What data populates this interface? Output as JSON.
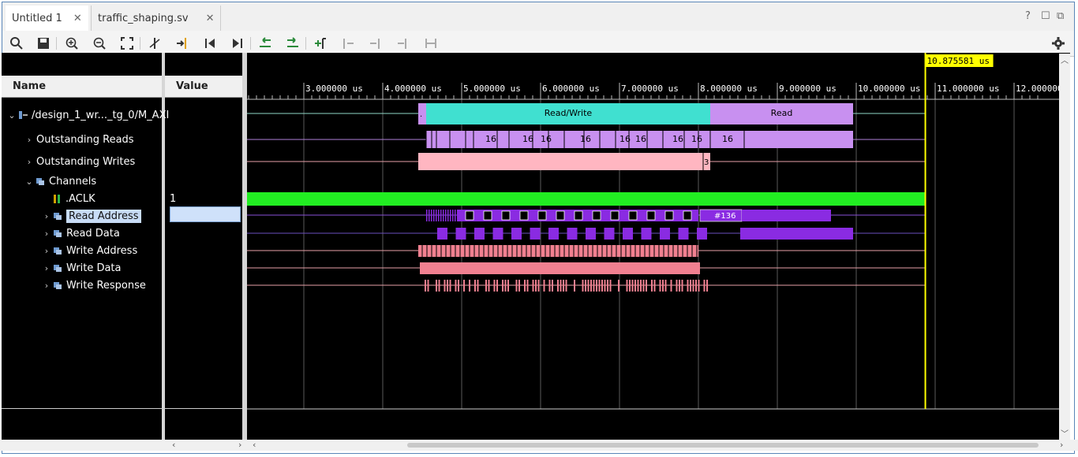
{
  "tabs": [
    {
      "label": "Untitled 1",
      "active": true
    },
    {
      "label": "traffic_shaping.sv",
      "active": false
    }
  ],
  "window_controls": {
    "help": "?",
    "restore": "☐",
    "maximize": "⧉"
  },
  "toolbar": {
    "icons": [
      "search-icon",
      "save-icon",
      "zoom-in-icon",
      "zoom-out-icon",
      "zoom-fit-icon",
      "cursor-icon",
      "go-to-cursor-icon",
      "go-to-start-icon",
      "go-to-end-icon",
      "previous-transition-icon",
      "next-transition-icon",
      "add-marker-icon",
      "previous-marker-icon",
      "next-marker-icon",
      "swap-cursors-icon",
      "snap-icon",
      "settings-icon"
    ]
  },
  "columns": {
    "name": "Name",
    "value": "Value"
  },
  "signals": [
    {
      "label": "/design_1_wr..._tg_0/M_AXI",
      "indent": 0,
      "chev": "⌄",
      "icon": "top",
      "value": ""
    },
    {
      "label": "Outstanding Reads",
      "indent": 1,
      "chev": "›",
      "icon": "",
      "value": ""
    },
    {
      "label": "Outstanding Writes",
      "indent": 1,
      "chev": "›",
      "icon": "",
      "value": ""
    },
    {
      "label": "Channels",
      "indent": 1,
      "chev": "⌄",
      "icon": "bus",
      "value": ""
    },
    {
      "label": ".ACLK",
      "indent": 2,
      "chev": "",
      "icon": "clk",
      "value": "1"
    },
    {
      "label": "Read Address",
      "indent": 2,
      "chev": "›",
      "icon": "bus",
      "value": "",
      "selected": true
    },
    {
      "label": "Read Data",
      "indent": 2,
      "chev": "›",
      "icon": "bus",
      "value": ""
    },
    {
      "label": "Write Address",
      "indent": 2,
      "chev": "›",
      "icon": "bus",
      "value": ""
    },
    {
      "label": "Write Data",
      "indent": 2,
      "chev": "›",
      "icon": "bus",
      "value": ""
    },
    {
      "label": "Write Response",
      "indent": 2,
      "chev": "›",
      "icon": "bus",
      "value": ""
    }
  ],
  "cursor": {
    "label": "10.875581 us",
    "time_us": 10.875581,
    "color": "#ffff00"
  },
  "time_axis": {
    "ticks": [
      "3.000000 us",
      "4.000000 us",
      "5.000000 us",
      "6.000000 us",
      "7.000000 us",
      "8.000000 us",
      "9.000000 us",
      "10.000000 us",
      "11.000000 us",
      "12.000000"
    ],
    "first_us": 3,
    "last_us": 12
  },
  "waves": {
    "transaction_labels": {
      "read_write": "Read/Write",
      "read": "Read",
      "dot": "."
    },
    "outstanding_read_labels": [
      "16",
      "16",
      "16",
      "16",
      "16",
      "16",
      "16",
      "16",
      "16"
    ],
    "outstanding_write_label": "3",
    "read_address_label": "#136",
    "colors": {
      "teal": "#40e0d0",
      "lavender": "#c890f0",
      "pink": "#ffb6c1",
      "green": "#22ee22",
      "violet": "#8a2be2",
      "salmon": "#f08090",
      "trace_blue": "#8060c8",
      "trace_pink": "#e8a0a8"
    }
  }
}
